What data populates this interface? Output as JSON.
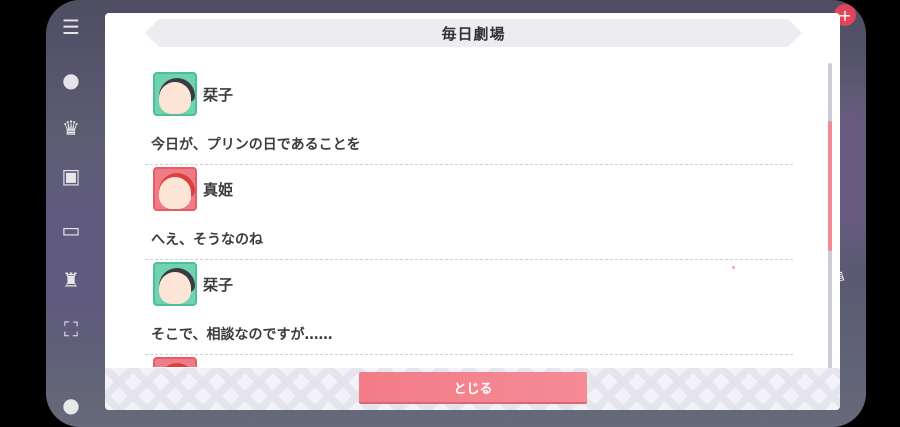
{
  "dialog": {
    "title": "毎日劇場",
    "close_label": "とじる"
  },
  "entries": [
    {
      "speaker": "栞子",
      "line": "今日が、プリンの日であることを",
      "avatar_color": "#6fd3b1"
    },
    {
      "speaker": "真姫",
      "line": "へえ、そうなのね",
      "avatar_color": "#f07b84"
    },
    {
      "speaker": "栞子",
      "line": "そこで、相談なのですが……",
      "avatar_color": "#6fd3b1"
    }
  ],
  "colors": {
    "accent": "#f27c88",
    "scroll_thumb": "#f08a96",
    "title_bar": "#ececf1"
  },
  "scroll": {
    "position_fraction": 0.19,
    "visible_fraction": 0.42
  },
  "background": {
    "rail_icons": [
      "menu-icon",
      "chat-icon",
      "crown-icon",
      "gift-icon",
      "screen-icon",
      "trophy-icon",
      "expand-icon",
      "profile-icon"
    ],
    "right_label": "合宿"
  }
}
